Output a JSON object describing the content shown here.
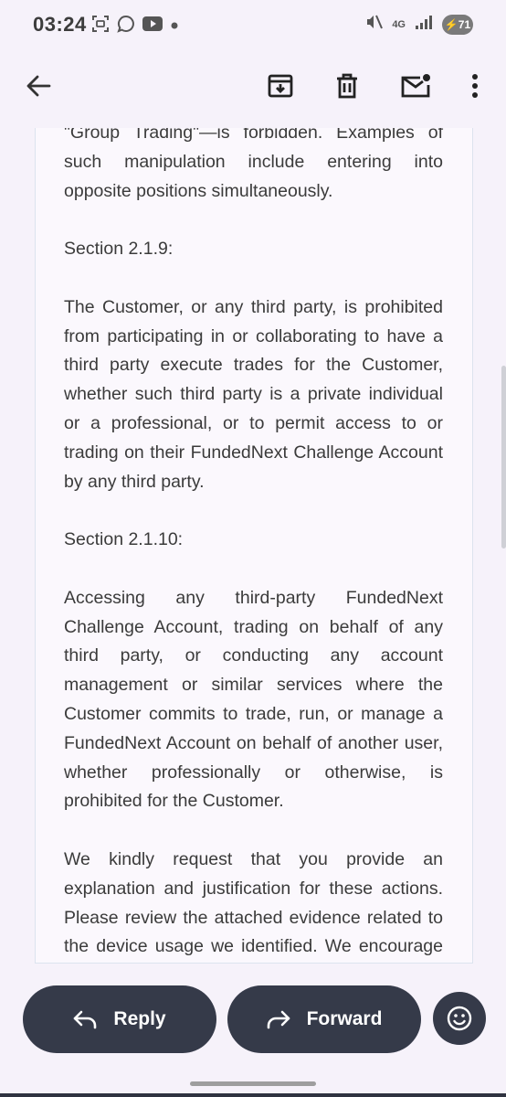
{
  "status": {
    "time": "03:24",
    "network": "4G",
    "battery": "71"
  },
  "toolbar": {
    "back_icon": "arrow-left-icon",
    "archive_icon": "archive-icon",
    "delete_icon": "trash-icon",
    "mark_unread_icon": "mail-unread-icon",
    "more_icon": "more-vertical-icon"
  },
  "email": {
    "paragraphs": [
      "\"Group Trading\"—is forbidden. Examples of such manipulation include entering into opposite positions simultaneously.",
      "Section 2.1.9:",
      "The Customer, or any third party, is prohibited from participating in or collaborating to have a third party execute trades for the Customer, whether such third party is a private individual or a professional, or to permit access to or trading on their FundedNext Challenge Account by any third party.",
      "Section 2.1.10:",
      "Accessing any third-party FundedNext Challenge Account, trading on behalf of any third party, or conducting any account management or similar services where the Customer commits to trade, run, or manage a FundedNext Account on behalf of another user, whether professionally or otherwise, is prohibited for the Customer.",
      "We kindly request that you provide an explanation and justification for these actions. Please review the attached evidence related to the device usage we identified. We encourage you to share any relevant details"
    ]
  },
  "actions": {
    "reply_label": "Reply",
    "forward_label": "Forward"
  }
}
